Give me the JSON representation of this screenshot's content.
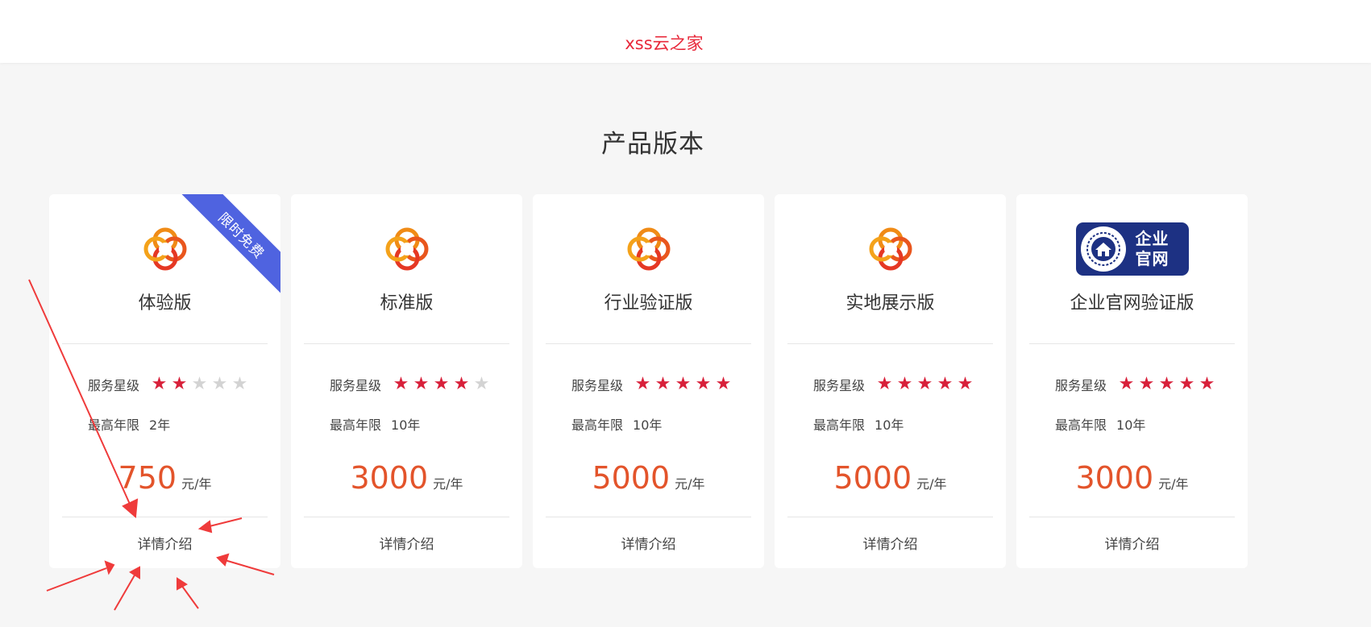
{
  "header": {
    "brand": "xss云之家"
  },
  "section": {
    "title": "产品版本"
  },
  "labels": {
    "service_level": "服务星级",
    "max_years": "最高年限",
    "unit": "元/年",
    "details": "详情介绍"
  },
  "ribbon": {
    "text": "限时免费",
    "color": "#4f63e0"
  },
  "colors": {
    "brand": "#e8283a",
    "price": "#e3542b",
    "star_on": "#d8203a",
    "star_off": "#d3d3d3",
    "badge": "#1d3183"
  },
  "badge": {
    "line1": "企业",
    "line2": "官网"
  },
  "products": [
    {
      "name": "体验版",
      "icon": "orange-swirl-logo",
      "stars": 2,
      "stars_max": 5,
      "years": "2年",
      "price": "750",
      "has_ribbon": true
    },
    {
      "name": "标准版",
      "icon": "orange-swirl-logo",
      "stars": 4,
      "stars_max": 5,
      "years": "10年",
      "price": "3000",
      "has_ribbon": false
    },
    {
      "name": "行业验证版",
      "icon": "orange-swirl-logo",
      "stars": 5,
      "stars_max": 5,
      "years": "10年",
      "price": "5000",
      "has_ribbon": false
    },
    {
      "name": "实地展示版",
      "icon": "orange-swirl-logo",
      "stars": 5,
      "stars_max": 5,
      "years": "10年",
      "price": "5000",
      "has_ribbon": false
    },
    {
      "name": "企业官网验证版",
      "icon": "enterprise-website-badge",
      "stars": 5,
      "stars_max": 5,
      "years": "10年",
      "price": "3000",
      "has_ribbon": false
    }
  ]
}
